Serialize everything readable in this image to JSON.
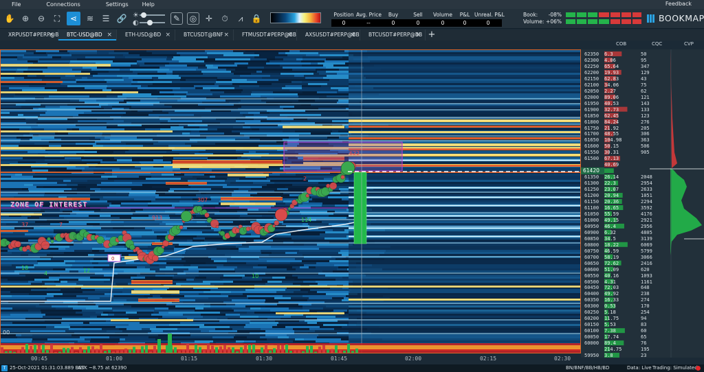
{
  "menu": {
    "items": [
      "File",
      "Connections",
      "Settings",
      "Help"
    ],
    "feedback": "Feedback"
  },
  "toolbar": {
    "icons": [
      "hand-icon",
      "zoom-in-icon",
      "zoom-out-icon",
      "fit-icon",
      "share-icon",
      "layers-icon",
      "stack-icon",
      "link-icon",
      "brightness-slider",
      "contrast-slider",
      "pencil-icon",
      "target-icon",
      "crosshair-icon",
      "timer-icon",
      "trend-icon",
      "lock-icon"
    ]
  },
  "stats": {
    "headers": [
      "Position",
      "Avg. Price",
      "Buy",
      "Sell",
      "Volume",
      "P&L",
      "Unreal. P&L"
    ],
    "values": [
      "0",
      "--",
      "0",
      "0",
      "0",
      "0",
      "0"
    ]
  },
  "book_volume": {
    "book_label": "Book:",
    "book_value": "-08%",
    "volume_label": "Volume:",
    "volume_value": "+06%"
  },
  "logo": "BOOKMAP",
  "tabs": [
    {
      "label": "XRPUSDT#PERP@BB",
      "active": false
    },
    {
      "label": "BTC-USD@BD",
      "active": true
    },
    {
      "label": "ETH-USD@BD",
      "active": false
    },
    {
      "label": "BTCUSDT@BNF",
      "active": false
    },
    {
      "label": "FTMUSDT#PERP@BB",
      "active": false
    },
    {
      "label": "AXSUSDT#PERP@BB",
      "active": false
    },
    {
      "label": "BTCUSDT#PERP@BB",
      "active": false
    }
  ],
  "tab_close": "×",
  "tab_add": "+",
  "side_headers": [
    "COB",
    "CQC",
    "CVP"
  ],
  "price_ladder": [
    {
      "price": "62350",
      "cob": "6.3",
      "cqc": "50"
    },
    {
      "price": "62300",
      "cob": "4.06",
      "cqc": "95"
    },
    {
      "price": "62250",
      "cob": "65.64",
      "cqc": "347"
    },
    {
      "price": "62200",
      "cob": "19.93",
      "cqc": "129"
    },
    {
      "price": "62150",
      "cob": "62.83",
      "cqc": "43"
    },
    {
      "price": "62100",
      "cob": "34.06",
      "cqc": "75"
    },
    {
      "price": "62050",
      "cob": "2.27",
      "cqc": "62"
    },
    {
      "price": "62000",
      "cob": "89.06",
      "cqc": "121"
    },
    {
      "price": "61950",
      "cob": "40.53",
      "cqc": "143"
    },
    {
      "price": "61900",
      "cob": "32.73",
      "cqc": "133"
    },
    {
      "price": "61850",
      "cob": "62.45",
      "cqc": "123"
    },
    {
      "price": "61800",
      "cob": "84.24",
      "cqc": "276"
    },
    {
      "price": "61750",
      "cob": "21.92",
      "cqc": "205"
    },
    {
      "price": "61700",
      "cob": "48.55",
      "cqc": "306"
    },
    {
      "price": "61650",
      "cob": "104.98",
      "cqc": "363"
    },
    {
      "price": "61600",
      "cob": "50.15",
      "cqc": "506"
    },
    {
      "price": "61550",
      "cob": "30.31",
      "cqc": "905"
    },
    {
      "price": "61500",
      "cob": "67.13",
      "cqc": ""
    },
    {
      "price": "",
      "cob": "40.69",
      "cqc": ""
    },
    {
      "price": "61420",
      "cob": "",
      "cqc": ""
    },
    {
      "price": "61350",
      "cob": "26.14",
      "cqc": "2048"
    },
    {
      "price": "61300",
      "cob": "22.3",
      "cqc": "2954"
    },
    {
      "price": "61250",
      "cob": "23.07",
      "cqc": "2633"
    },
    {
      "price": "61200",
      "cob": "20.94",
      "cqc": "1051"
    },
    {
      "price": "61150",
      "cob": "20.36",
      "cqc": "2294"
    },
    {
      "price": "61100",
      "cob": "16.65",
      "cqc": "3592"
    },
    {
      "price": "61050",
      "cob": "55.59",
      "cqc": "4176"
    },
    {
      "price": "61000",
      "cob": "49.15",
      "cqc": "2921"
    },
    {
      "price": "60950",
      "cob": "46.4",
      "cqc": "2956"
    },
    {
      "price": "60900",
      "cob": "6.32",
      "cqc": "4805"
    },
    {
      "price": "60850",
      "cob": "34.5",
      "cqc": "3139"
    },
    {
      "price": "60800",
      "cob": "18.22",
      "cqc": "6069"
    },
    {
      "price": "60750",
      "cob": "46.59",
      "cqc": "5799"
    },
    {
      "price": "60700",
      "cob": "58.19",
      "cqc": "3066"
    },
    {
      "price": "60650",
      "cob": "72.62",
      "cqc": "2416"
    },
    {
      "price": "60600",
      "cob": "51.09",
      "cqc": "620"
    },
    {
      "price": "60550",
      "cob": "40.16",
      "cqc": "1093"
    },
    {
      "price": "60500",
      "cob": "4.31",
      "cqc": "1161"
    },
    {
      "price": "60450",
      "cob": "72.03",
      "cqc": "648"
    },
    {
      "price": "60400",
      "cob": "49.92",
      "cqc": "238"
    },
    {
      "price": "60350",
      "cob": "16.33",
      "cqc": "274"
    },
    {
      "price": "60300",
      "cob": "0.53",
      "cqc": "170"
    },
    {
      "price": "60250",
      "cob": "5.18",
      "cqc": "254"
    },
    {
      "price": "60200",
      "cob": "11.75",
      "cqc": "94"
    },
    {
      "price": "60150",
      "cob": "5.53",
      "cqc": "83"
    },
    {
      "price": "60100",
      "cob": "7.38",
      "cqc": "60"
    },
    {
      "price": "60050",
      "cob": "17.74",
      "cqc": "65"
    },
    {
      "price": "60000",
      "cob": "89.4",
      "cqc": "76"
    },
    {
      "price": "",
      "cob": "214.75",
      "cqc": "195"
    },
    {
      "price": "59950",
      "cob": "3.8",
      "cqc": "23"
    }
  ],
  "cur_price": "61420",
  "time_ticks": [
    "00:45",
    "01:00",
    "01:15",
    "01:30",
    "01:45",
    "02:00",
    "02:15",
    "02:30"
  ],
  "chart_labels": {
    "zone": "ZONE OF INTEREST",
    "marker_0": "0",
    "annotations": [
      "37",
      "7",
      "18",
      "4",
      "12",
      "913",
      "307",
      "622",
      "2",
      "114",
      "10",
      "00"
    ]
  },
  "status": {
    "t_icon": "T",
    "datetime": "25-Oct-2021 01:31:03.889 BST",
    "ask": "ASK ~8.75 at 62390",
    "brokers": "BN/BNF/BB/HB/BD",
    "data": "Data: Live",
    "trading": "Trading: Simulated"
  }
}
